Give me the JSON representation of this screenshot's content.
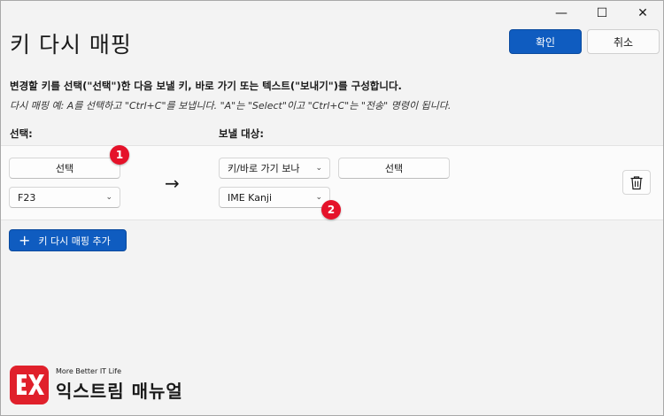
{
  "window": {
    "title": "키 다시 매핑",
    "caption": {
      "minimize_glyph": "—",
      "maximize_glyph": "☐",
      "close_glyph": "✕"
    }
  },
  "header": {
    "confirm_label": "확인",
    "cancel_label": "취소"
  },
  "description": {
    "main": "변경할 키를 선택(\"선택\")한 다음 보낼 키, 바로 가기 또는 텍스트(\"보내기\")를 구성합니다.",
    "example": "다시 매핑 예: A를 선택하고 \"Ctrl+C\"를 보냅니다. \"A\"는 \"Select\"이고 \"Ctrl+C\"는 \"전송\" 명령이 됩니다."
  },
  "columns": {
    "select_label": "선택:",
    "send_label": "보낼 대상:"
  },
  "mapping": {
    "select_button_label": "선택",
    "source_key_value": "F23",
    "arrow_glyph": "→",
    "send_type_value": "키/바로 가기 보나",
    "send_select_button_label": "선택",
    "target_key_value": "IME Kanji",
    "chevron_glyph": "⌄"
  },
  "annotations": {
    "badge_1": "1",
    "badge_2": "2"
  },
  "actions": {
    "add_mapping_label": "키 다시 매핑 추가",
    "add_icon": "+"
  },
  "watermark": {
    "tagline": "More Better IT Life",
    "name": "익스트림 매뉴얼"
  },
  "colors": {
    "accent": "#0f5cc0",
    "badge": "#e5122a",
    "logo": "#e0202b",
    "window_bg": "#f3f3f3"
  },
  "icons": [
    "minimize-icon",
    "maximize-icon",
    "close-icon",
    "chevron-down-icon",
    "arrow-right-icon",
    "trash-icon",
    "plus-icon",
    "logo-icon"
  ]
}
